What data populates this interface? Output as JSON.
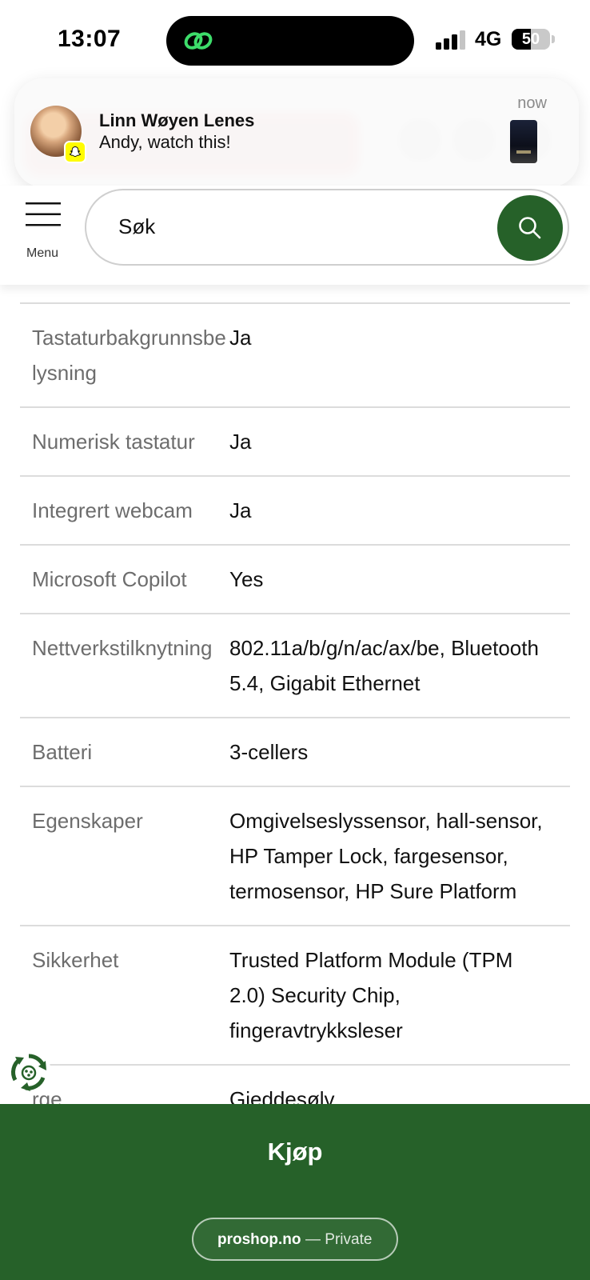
{
  "status_bar": {
    "time": "13:07",
    "network": "4G",
    "battery_level": "50"
  },
  "notification": {
    "sender": "Linn Wøyen Lenes",
    "message": "Andy, watch this!",
    "time": "now",
    "app_icon": "snapchat-icon"
  },
  "header": {
    "menu_label": "Menu",
    "search_placeholder": "Søk",
    "search_icon": "magnifier-icon"
  },
  "specs": [
    {
      "label": "Tastaturbakgrunnsbelysning",
      "value": "Ja"
    },
    {
      "label": "Numerisk tastatur",
      "value": "Ja"
    },
    {
      "label": "Integrert webcam",
      "value": "Ja"
    },
    {
      "label": "Microsoft Copilot",
      "value": "Yes"
    },
    {
      "label": "Nettverkstilknytning",
      "value": "802.11a/b/g/n/ac/ax/be, Bluetooth 5.4, Gigabit Ethernet"
    },
    {
      "label": "Batteri",
      "value": "3-cellers"
    },
    {
      "label": "Egenskaper",
      "value": "Omgivelseslyssensor, hall-sensor, HP Tamper Lock, fargesensor, termosensor, HP Sure Platform"
    },
    {
      "label": "Sikkerhet",
      "value": "Trusted Platform Module (TPM 2.0) Security Chip, fingeravtrykksleser"
    },
    {
      "label": "rge",
      "value": "Gjeddesølv"
    }
  ],
  "buy_bar": {
    "buy_label": "Kjøp",
    "url_domain": "proshop.no",
    "url_suffix": "— Private"
  },
  "colors": {
    "brand_green": "#266129"
  }
}
